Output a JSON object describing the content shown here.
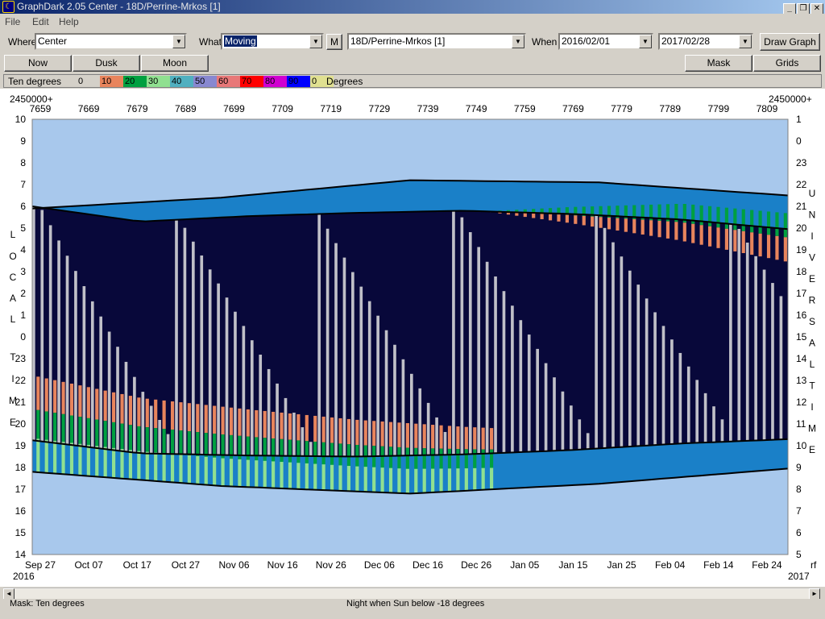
{
  "window": {
    "title": "GraphDark 2.05  Center  -  18D/Perrine-Mrkos [1]",
    "buttons": [
      "_",
      "❐",
      "✕"
    ]
  },
  "menu": [
    "File",
    "Edit",
    "Help"
  ],
  "toolbar": {
    "where_label": "Where",
    "where_value": "Center",
    "what_label": "What",
    "what_value": "Moving",
    "m_button": "M",
    "object_value": "18D/Perrine-Mrkos [1]",
    "when_label": "When",
    "start_date": "2016/02/01",
    "end_date": "2017/02/28",
    "draw_button": "Draw Graph"
  },
  "buttons2": {
    "now": "Now",
    "dusk": "Dusk",
    "moon": "Moon",
    "mask": "Mask",
    "grids": "Grids"
  },
  "legend": {
    "label": "Ten degrees",
    "unit": "Degrees",
    "entries": [
      {
        "value": "0",
        "color": "#d4d0c8"
      },
      {
        "value": "10",
        "color": "#e8845c"
      },
      {
        "value": "20",
        "color": "#00a040"
      },
      {
        "value": "30",
        "color": "#90e090"
      },
      {
        "value": "40",
        "color": "#50b0c0"
      },
      {
        "value": "50",
        "color": "#8888d0"
      },
      {
        "value": "60",
        "color": "#e87878"
      },
      {
        "value": "70",
        "color": "#ff0000"
      },
      {
        "value": "80",
        "color": "#d000d0"
      },
      {
        "value": "90",
        "color": "#0000ff"
      },
      {
        "value": "0",
        "color": "#e0e090"
      }
    ]
  },
  "chart_data": {
    "type": "heatmap",
    "title": "",
    "jd_prefix_left": "2450000+",
    "jd_prefix_right": "2450000+",
    "jd_ticks": [
      "7659",
      "7669",
      "7679",
      "7689",
      "7699",
      "7709",
      "7719",
      "7729",
      "7739",
      "7749",
      "7759",
      "7769",
      "7779",
      "7789",
      "7799",
      "7809"
    ],
    "date_ticks": [
      "Sep 27",
      "Oct 07",
      "Oct 17",
      "Oct 27",
      "Nov 06",
      "Nov 16",
      "Nov 26",
      "Dec 06",
      "Dec 16",
      "Dec 26",
      "Jan 05",
      "Jan 15",
      "Jan 25",
      "Feb 04",
      "Feb 14",
      "Feb 24"
    ],
    "year_start": "2016",
    "year_end": "2017",
    "right_corner_label": "rf",
    "left_axis_label": "LOCAL TIME",
    "left_axis_ticks": [
      "10",
      "9",
      "8",
      "7",
      "6",
      "5",
      "4",
      "3",
      "2",
      "1",
      "0",
      "23",
      "22",
      "21",
      "20",
      "19",
      "18",
      "17",
      "16",
      "15",
      "14"
    ],
    "right_axis_label": "UNIVERSAL TIME",
    "right_axis_ticks": [
      "1",
      "0",
      "23",
      "22",
      "21",
      "20",
      "19",
      "18",
      "17",
      "16",
      "15",
      "14",
      "13",
      "12",
      "11",
      "10",
      "9",
      "8",
      "7",
      "6",
      "5"
    ],
    "colors": {
      "day": "#a8c8ec",
      "twilight": "#1a80c8",
      "night": "#08083a",
      "moon": "#c0c0c8",
      "curve": "#000000"
    },
    "night_start_hours": [
      6.0,
      5.3,
      5.55,
      5.7,
      5.8,
      5.65,
      5.4,
      4.95
    ],
    "night_end_hours": [
      19.25,
      18.65,
      18.55,
      18.5,
      18.6,
      18.8,
      19.1,
      19.3
    ],
    "dusk_start_hours": [
      5.9,
      6.4,
      7.2,
      7.1,
      6.5
    ],
    "dawn_end_hours": [
      17.8,
      17.15,
      16.8,
      17.25,
      17.95
    ],
    "grid": false
  },
  "status": {
    "mask": "Mask:  Ten degrees",
    "night": "Night when Sun below -18 degrees"
  },
  "scroll": {
    "left": "◄",
    "right": "►"
  }
}
